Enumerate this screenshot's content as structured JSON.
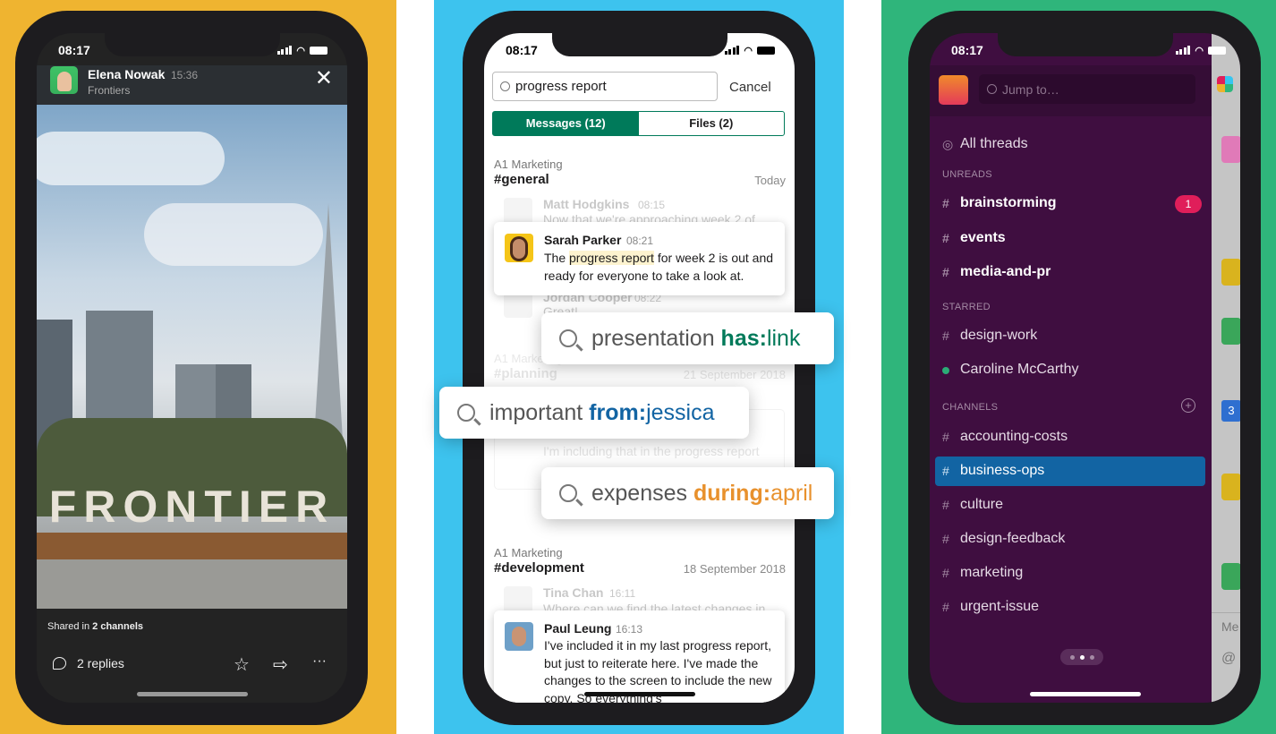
{
  "colors": {
    "panel_left": "#efb430",
    "panel_mid": "#3dc3ee",
    "panel_right": "#2fb57b",
    "slack_green": "#007a5a",
    "slack_purple": "#3f0e40",
    "active_blue": "#1264a3",
    "badge_red": "#e01e5a",
    "highlight": "#fdf3cf",
    "has_green": "#007a5a",
    "from_blue": "#1264a3",
    "during_orange": "#e8912d"
  },
  "status_time": "08:17",
  "phone1": {
    "sender": "Elena Nowak",
    "time": "15:36",
    "channel": "Frontiers",
    "photo_sign": "FRONTIER",
    "shared_prefix": "Shared in ",
    "shared_count": "2 channels",
    "replies": "2 replies",
    "icons": [
      "thread-icon",
      "star-icon",
      "share-icon",
      "more-icon",
      "close-icon"
    ]
  },
  "phone2": {
    "search_value": "progress report",
    "cancel": "Cancel",
    "tabs": [
      {
        "label": "Messages (12)",
        "active": true
      },
      {
        "label": "Files (2)",
        "active": false
      }
    ],
    "groups": [
      {
        "workspace": "A1 Marketing",
        "channel": "#general",
        "date": "Today",
        "faded_before": {
          "name": "Matt Hodgkins",
          "time": "08:15",
          "text": "Now that we're approaching week 2 of"
        },
        "hit": {
          "name": "Sarah Parker",
          "time": "08:21",
          "pre": "The ",
          "match": "progress report",
          "post": " for week 2 is out and ready for everyone to take a look at."
        },
        "faded_after": {
          "name": "Jordan Cooper",
          "time": "08:22",
          "text": "Great!"
        }
      },
      {
        "workspace": "A1 Marketing",
        "channel": "#planning",
        "date": "21 September 2018",
        "faded_text": "I'm including that in the progress report"
      },
      {
        "workspace": "A1 Marketing",
        "channel": "#development",
        "date": "18 September 2018",
        "faded_before": {
          "name": "Tina Chan",
          "time": "16:11",
          "text": "Where can we find the latest changes in"
        },
        "hit": {
          "name": "Paul Leung",
          "time": "16:13",
          "text": "I've included it in my last progress report, but just to reiterate here. I've made the changes to the screen to include the new copy. So everything's"
        }
      }
    ],
    "floats": [
      {
        "term": "presentation ",
        "modifier": "has:",
        "value": "link"
      },
      {
        "term": "important ",
        "modifier": "from:",
        "value": "jessica"
      },
      {
        "term": "expenses ",
        "modifier": "during:",
        "value": "april"
      }
    ]
  },
  "phone3": {
    "search_placeholder": "Jump to…",
    "all_threads": "All threads",
    "sections": {
      "unreads": "UNREADS",
      "starred": "STARRED",
      "channels": "CHANNELS"
    },
    "unreads": [
      {
        "name": "brainstorming",
        "badge": "1"
      },
      {
        "name": "events"
      },
      {
        "name": "media-and-pr"
      }
    ],
    "starred": [
      {
        "name": "design-work",
        "type": "channel"
      },
      {
        "name": "Caroline McCarthy",
        "type": "dm",
        "online": true
      }
    ],
    "channels": [
      {
        "name": "accounting-costs"
      },
      {
        "name": "business-ops",
        "active": true
      },
      {
        "name": "culture"
      },
      {
        "name": "design-feedback"
      },
      {
        "name": "marketing"
      },
      {
        "name": "urgent-issue"
      }
    ],
    "peek_calendar": "3",
    "peek_input": "Me",
    "peek_at": "@"
  }
}
